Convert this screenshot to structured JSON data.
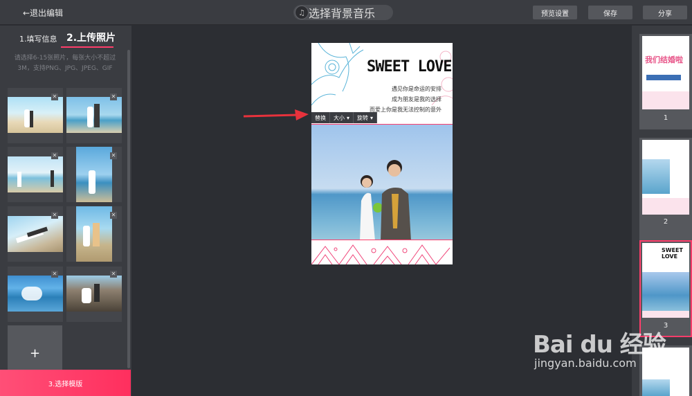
{
  "header": {
    "back_label": "←退出编辑",
    "music_label": "选择背景音乐",
    "preview_label": "预览设置",
    "save_label": "保存",
    "share_label": "分享"
  },
  "left_panel": {
    "step1_label": "1.填写信息",
    "step2_label": "2.上传照片",
    "hint_text": "请选择6-15张照片，每张大小不超过3M，支持PNG、JPG、JPEG、GIF",
    "add_label": "+",
    "next_step_label": "3.选择模版",
    "photos": [
      {
        "name": "photo-1"
      },
      {
        "name": "photo-2"
      },
      {
        "name": "photo-3"
      },
      {
        "name": "photo-4"
      },
      {
        "name": "photo-5"
      },
      {
        "name": "photo-6"
      },
      {
        "name": "photo-7"
      },
      {
        "name": "photo-8"
      }
    ]
  },
  "canvas": {
    "title": "SWEET LOVE",
    "lines": [
      "遇见你是命运的安排",
      "成为朋友是我的选择",
      "而爱上你是我无法控制的意外"
    ],
    "tools": {
      "replace": "替换",
      "size": "大小",
      "rotate": "旋转"
    }
  },
  "right_panel": {
    "pages": [
      {
        "num": "1",
        "title": "我们结婚啦"
      },
      {
        "num": "2"
      },
      {
        "num": "3",
        "title": "SWEET LOVE"
      }
    ]
  },
  "watermark": {
    "brand": "Bai du 经验",
    "url": "jingyan.baidu.com"
  },
  "colors": {
    "accent": "#ff3d6b",
    "panel": "#3a3c41",
    "background": "#2c2e33"
  }
}
